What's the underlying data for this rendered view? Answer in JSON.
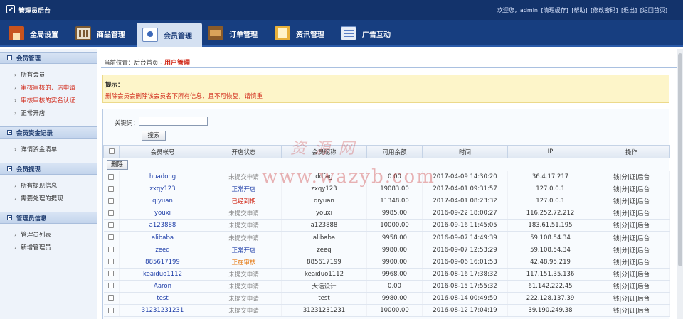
{
  "topbar": {
    "title": "管理员后台",
    "greeting": "欢迎您，admin",
    "links": [
      "[清理缓存]",
      "[帮助]",
      "[修改密码]",
      "[退出]",
      "[返回首页]"
    ]
  },
  "nav": [
    {
      "label": "全局设置",
      "icon": "home-icon"
    },
    {
      "label": "商品管理",
      "icon": "goods-icon"
    },
    {
      "label": "会员管理",
      "icon": "member-icon",
      "active": true
    },
    {
      "label": "订单管理",
      "icon": "order-icon"
    },
    {
      "label": "资讯管理",
      "icon": "news-icon"
    },
    {
      "label": "广告互动",
      "icon": "ad-icon"
    }
  ],
  "sidebar": {
    "groups": [
      {
        "title": "会员管理",
        "items": [
          {
            "label": "所有会员",
            "red": false
          },
          {
            "label": "审核审核的开店申请",
            "red": true
          },
          {
            "label": "审核审核的实名认证",
            "red": true
          },
          {
            "label": "正常开店",
            "red": false
          }
        ]
      },
      {
        "title": "会员资金记录",
        "items": [
          {
            "label": "详情资金清单",
            "red": false
          }
        ]
      },
      {
        "title": "会员提现",
        "items": [
          {
            "label": "所有提现信息",
            "red": false
          },
          {
            "label": "需要处理的提现",
            "red": false
          }
        ]
      },
      {
        "title": "管理员信息",
        "items": [
          {
            "label": "管理员列表",
            "red": false
          },
          {
            "label": "新增管理员",
            "red": false
          }
        ]
      }
    ]
  },
  "breadcrumb": {
    "prefix": "当前位置：",
    "home": "后台首页",
    "sep": " - ",
    "current": "用户管理"
  },
  "tip": {
    "title": "提示：",
    "text": "删除会员会删除该会员名下所有信息，且不可恢复，请慎重"
  },
  "search": {
    "label": "关键词：",
    "value": "",
    "button": "搜索"
  },
  "table": {
    "headers": [
      "会员帐号",
      "开店状态",
      "会员昵称",
      "可用余额",
      "时间",
      "IP",
      "操作"
    ],
    "delete_label": "删除",
    "ops_label": "钱|分|证|后台",
    "rows": [
      {
        "account": "huadong",
        "status": "未提交申请",
        "status_type": "none",
        "nickname": "ddfag",
        "balance": "0.00",
        "time": "2017-04-09 14:30:20",
        "ip": "36.4.17.217"
      },
      {
        "account": "zxqy123",
        "status": "正常开店",
        "status_type": "normal",
        "nickname": "zxqy123",
        "balance": "19083.00",
        "time": "2017-04-01 09:31:57",
        "ip": "127.0.0.1"
      },
      {
        "account": "qiyuan",
        "status": "已经到期",
        "status_type": "expired",
        "nickname": "qiyuan",
        "balance": "11348.00",
        "time": "2017-04-01 08:23:32",
        "ip": "127.0.0.1"
      },
      {
        "account": "youxi",
        "status": "未提交申请",
        "status_type": "none",
        "nickname": "youxi",
        "balance": "9985.00",
        "time": "2016-09-22 18:00:27",
        "ip": "116.252.72.212"
      },
      {
        "account": "a123888",
        "status": "未提交申请",
        "status_type": "none",
        "nickname": "a123888",
        "balance": "10000.00",
        "time": "2016-09-16 11:45:05",
        "ip": "183.61.51.195"
      },
      {
        "account": "alibaba",
        "status": "未提交申请",
        "status_type": "none",
        "nickname": "alibaba",
        "balance": "9958.00",
        "time": "2016-09-07 14:49:39",
        "ip": "59.108.54.34"
      },
      {
        "account": "zeeq",
        "status": "正常开店",
        "status_type": "normal",
        "nickname": "zeeq",
        "balance": "9980.00",
        "time": "2016-09-07 12:53:29",
        "ip": "59.108.54.34"
      },
      {
        "account": "885617199",
        "status": "正在审核",
        "status_type": "review",
        "nickname": "885617199",
        "balance": "9900.00",
        "time": "2016-09-06 16:01:53",
        "ip": "42.48.95.219"
      },
      {
        "account": "keaiduo1112",
        "status": "未提交申请",
        "status_type": "none",
        "nickname": "keaiduo1112",
        "balance": "9968.00",
        "time": "2016-08-16 17:38:32",
        "ip": "117.151.35.136"
      },
      {
        "account": "Aaron",
        "status": "未提交申请",
        "status_type": "none",
        "nickname": "大话设计",
        "balance": "0.00",
        "time": "2016-08-15 17:55:32",
        "ip": "61.142.222.45"
      },
      {
        "account": "test",
        "status": "未提交申请",
        "status_type": "none",
        "nickname": "test",
        "balance": "9980.00",
        "time": "2016-08-14 00:49:50",
        "ip": "222.128.137.39"
      },
      {
        "account": "31231231231",
        "status": "未提交申请",
        "status_type": "none",
        "nickname": "31231231231",
        "balance": "10000.00",
        "time": "2016-08-12 17:04:19",
        "ip": "39.190.249.38"
      }
    ]
  },
  "watermark": {
    "chars": "资源网",
    "url": "www.wazyb.com"
  }
}
